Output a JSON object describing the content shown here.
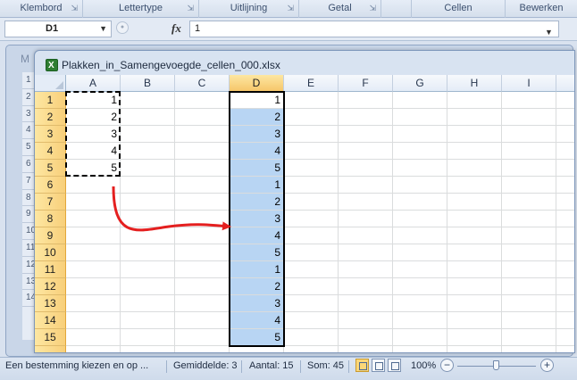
{
  "ribbon": {
    "groups": [
      {
        "label": "Klembord",
        "launcher": true
      },
      {
        "label": "Lettertype",
        "launcher": true
      },
      {
        "label": "Uitlijning",
        "launcher": true
      },
      {
        "label": "Getal",
        "launcher": true
      },
      {
        "label": "",
        "launcher": false
      },
      {
        "label": "Cellen",
        "launcher": false
      },
      {
        "label": "Bewerken",
        "launcher": false
      }
    ]
  },
  "formula_bar": {
    "name_box": "D1",
    "fx_label": "fx",
    "formula": "1"
  },
  "back_window": {
    "title_initial": "M",
    "row_numbers": [
      "1",
      "2",
      "3",
      "4",
      "5",
      "6",
      "7",
      "8",
      "9",
      "10",
      "11",
      "12",
      "13",
      "14"
    ]
  },
  "workbook": {
    "title": "Plakken_in_Samengevoegde_cellen_000.xlsx",
    "columns": [
      "A",
      "B",
      "C",
      "D",
      "E",
      "F",
      "G",
      "H",
      "I"
    ],
    "selected_column": "D",
    "rows": [
      "1",
      "2",
      "3",
      "4",
      "5",
      "6",
      "7",
      "8",
      "9",
      "10",
      "11",
      "12",
      "13",
      "14",
      "15"
    ],
    "column_a_values": [
      "1",
      "2",
      "3",
      "4",
      "5"
    ],
    "column_d_values": [
      "1",
      "2",
      "3",
      "4",
      "5",
      "1",
      "2",
      "3",
      "4",
      "5",
      "1",
      "2",
      "3",
      "4",
      "5"
    ],
    "active_cell": "D1",
    "copied_range": "A1:A5",
    "selection_range": "D1:D15",
    "arrow_color": "#e41f1f",
    "selection_color": "#b8d5f3"
  },
  "status_bar": {
    "message": "Een bestemming kiezen en op ...",
    "average": "Gemiddelde: 3",
    "count": "Aantal: 15",
    "sum": "Som: 45",
    "zoom": "100%",
    "zoom_level_percent": 100
  }
}
